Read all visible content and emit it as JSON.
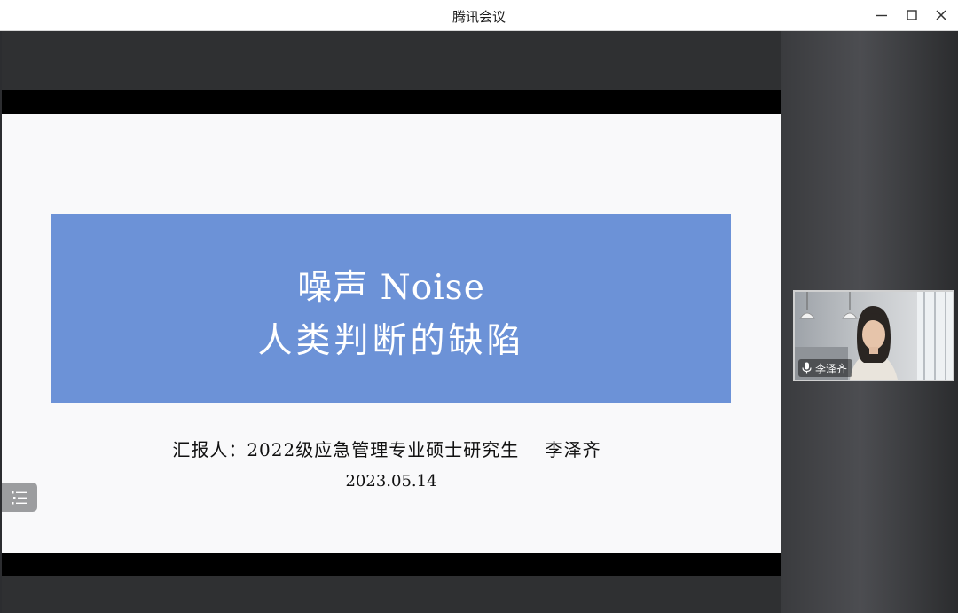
{
  "window": {
    "title": "腾讯会议",
    "controls": {
      "minimize_icon": "minimize-icon",
      "maximize_icon": "maximize-icon",
      "close_icon": "close-icon"
    }
  },
  "slide": {
    "banner_line1": "噪声 Noise",
    "banner_line2": "人类判断的缺陷",
    "reporter": "汇报人：2022级应急管理专业硕士研究生    李泽齐",
    "date": "2023.05.14",
    "banner_color": "#6c92d7"
  },
  "participant": {
    "name": "李泽齐",
    "mic_icon": "microphone-icon"
  },
  "toolbar": {
    "menu_icon": "list-menu-icon"
  }
}
